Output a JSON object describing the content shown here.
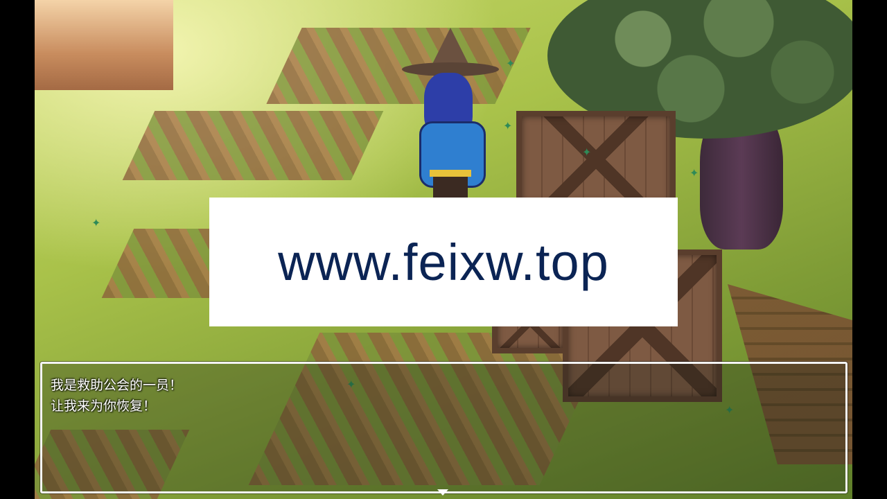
{
  "watermark": {
    "text": "www.feixw.top"
  },
  "dialog": {
    "lines": [
      "我是救助公会的一员！",
      "让我来为你恢复！"
    ]
  },
  "icons": {
    "continue": "triangle-down-icon",
    "sparkle": "leaf-sparkle-icon"
  },
  "colors": {
    "watermark_text": "#0b2454",
    "dialog_border": "#f4f4f4",
    "dialog_text": "#ffffff"
  }
}
